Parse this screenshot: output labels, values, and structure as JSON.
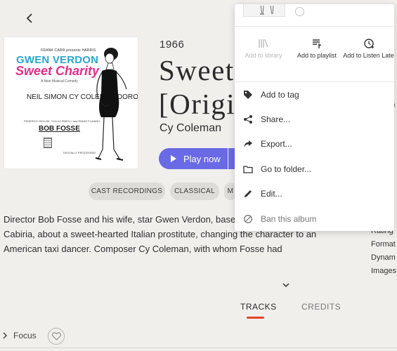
{
  "album": {
    "year": "1966",
    "title_line1": "Sweet",
    "title_line2": "[Origi",
    "artist": "Cy Coleman",
    "play_label": "Play now"
  },
  "cover": {
    "presents": "FRANK CARR presents HARRIS",
    "artist": "GWEN VERDON",
    "title": "Sweet Charity",
    "subtitle": "A New Musical Comedy",
    "names": "NEIL SIMON\nCY COLEMAN\nDOROTHY FIELDS",
    "credit": "FEDERICO FELLINI, TULLIO PINELLI and ENNIO FLAIANO",
    "director": "BOB FOSSE",
    "fine_print": "DIGITALLY PROCESSED"
  },
  "genres": [
    "CAST RECORDINGS",
    "CLASSICAL",
    "M"
  ],
  "description": "Director Bob Fosse and his wife, star Gwen Verdon, based Fellini's film Nights of Cabiria, about a sweet-hearted Italian prostitute, changing the character to an American taxi dancer. Composer Cy Coleman, with whom Fosse had",
  "meta": [
    "Rating",
    "Format",
    "Dynam",
    "Images"
  ],
  "tabs": {
    "tracks": "TRACKS",
    "credits": "CREDITS"
  },
  "focus_label": "Focus",
  "menu": {
    "quick_actions": [
      {
        "label": "Add to library",
        "icon": "library-icon",
        "disabled": true
      },
      {
        "label": "Add to playlist",
        "icon": "playlist-add-icon",
        "disabled": false
      },
      {
        "label": "Add to Listen Later",
        "icon": "clock-add-icon",
        "disabled": false
      }
    ],
    "items": [
      {
        "label": "Add to tag",
        "icon": "tag-icon"
      },
      {
        "label": "Share...",
        "icon": "share-icon"
      },
      {
        "label": "Export...",
        "icon": "export-icon"
      },
      {
        "label": "Go to folder...",
        "icon": "folder-icon"
      },
      {
        "label": "Edit...",
        "icon": "pencil-icon"
      },
      {
        "label": "Ban this album",
        "icon": "ban-icon"
      }
    ]
  },
  "colors": {
    "accent": "#6a6ae6",
    "tab_underline": "#e0452f",
    "cover_artist": "#2aa7c9",
    "cover_title": "#e22f8a"
  }
}
